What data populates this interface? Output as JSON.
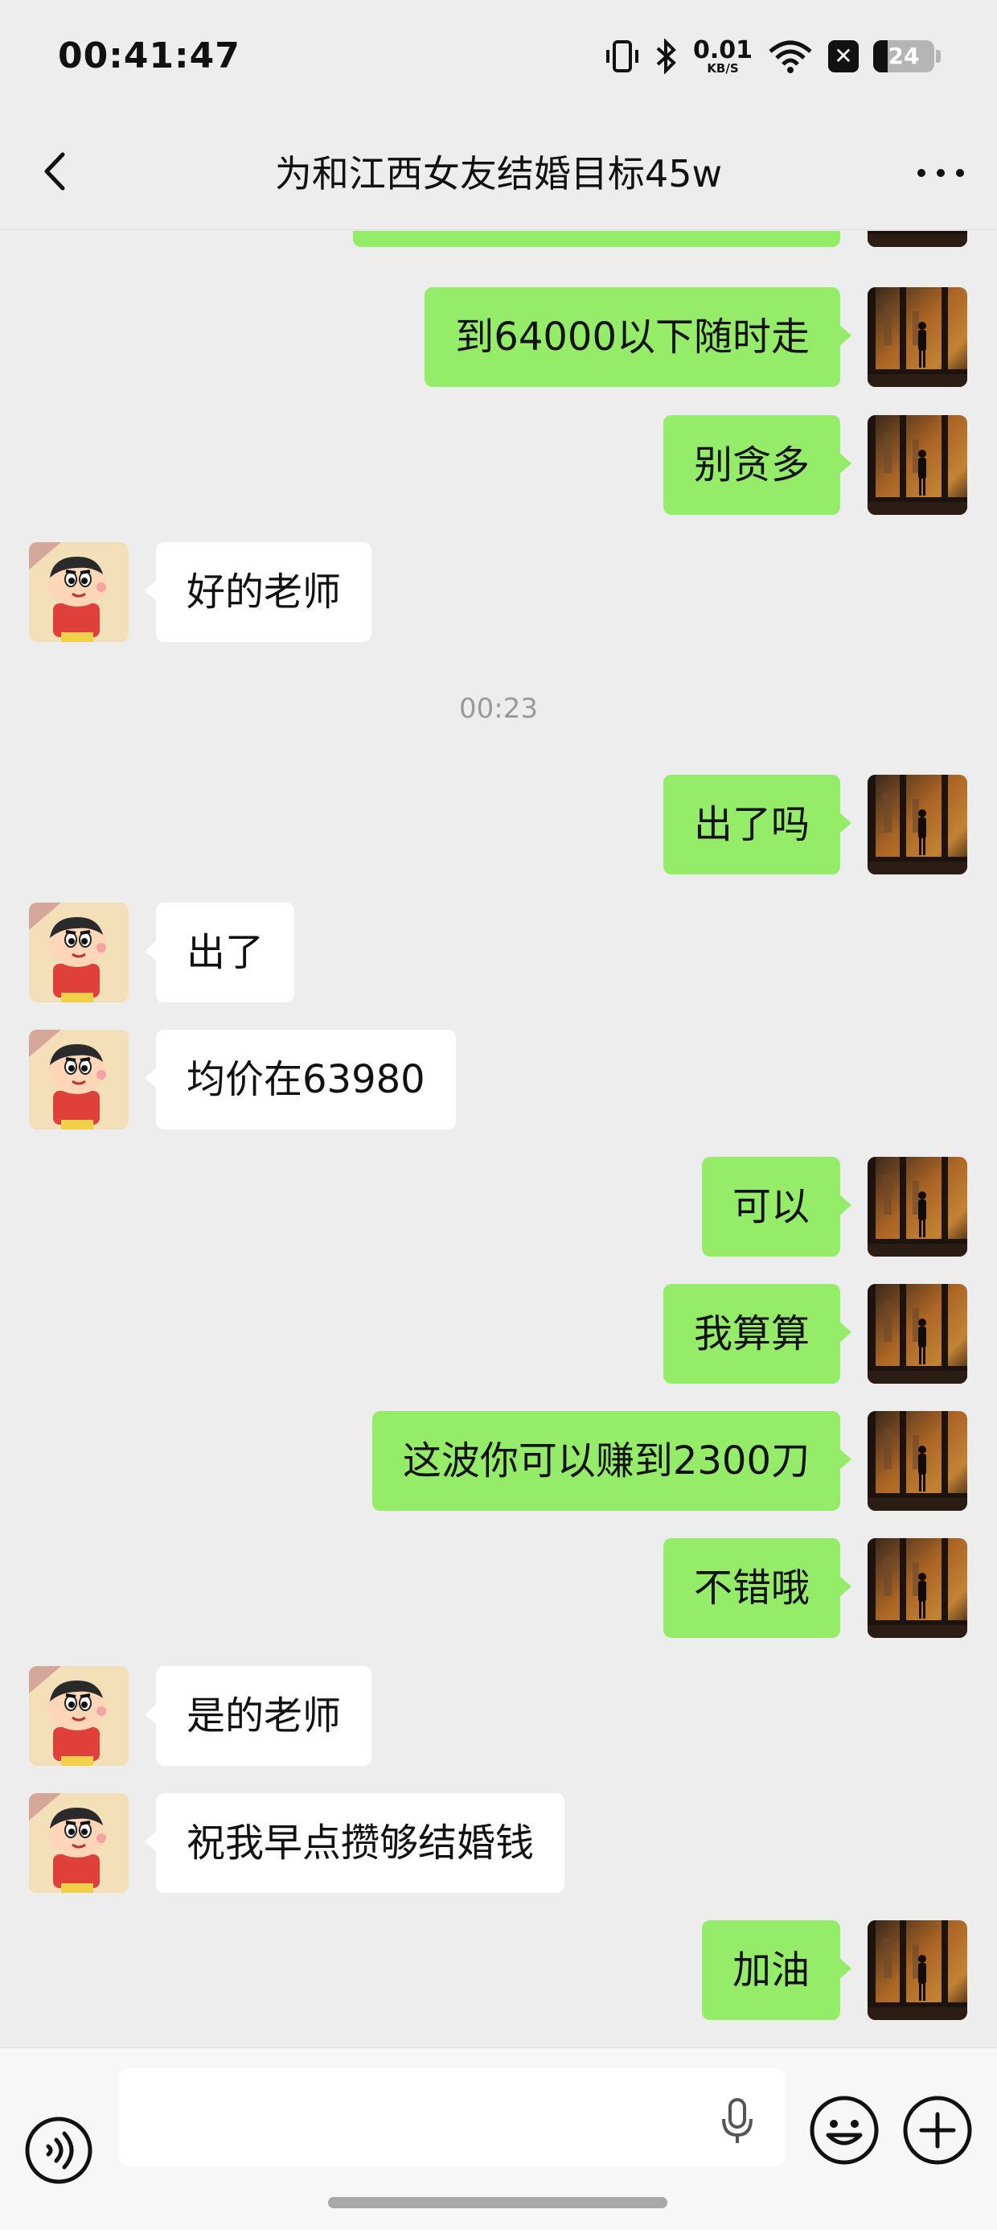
{
  "status_bar": {
    "time": "00:41:47",
    "net_speed_value": "0.01",
    "net_speed_unit": "KB/S",
    "battery": "24",
    "battery_level": 0.24,
    "icons": [
      "vibrate-icon",
      "bluetooth-icon",
      "wifi-icon",
      "x-badge-icon",
      "battery-icon"
    ]
  },
  "header": {
    "title": "为和江西女友结婚目标45w",
    "back_icon": "chevron-left-icon",
    "more_icon": "more-dots-icon"
  },
  "messages": [
    {
      "side": "right",
      "text": "到64000以下随时走"
    },
    {
      "side": "right",
      "text": "别贪多"
    },
    {
      "side": "left",
      "text": "好的老师"
    },
    {
      "type": "time",
      "text": "00:23"
    },
    {
      "side": "right",
      "text": "出了吗"
    },
    {
      "side": "left",
      "text": "出了"
    },
    {
      "side": "left",
      "text": "均价在63980"
    },
    {
      "side": "right",
      "text": "可以"
    },
    {
      "side": "right",
      "text": "我算算"
    },
    {
      "side": "right",
      "text": "这波你可以赚到2300刀"
    },
    {
      "side": "right",
      "text": "不错哦"
    },
    {
      "side": "left",
      "text": "是的老师"
    },
    {
      "side": "left",
      "text": "祝我早点攒够结婚钱"
    },
    {
      "side": "right",
      "text": "加油"
    }
  ],
  "input_bar": {
    "value": "",
    "voice_icon": "voice-mode-icon",
    "mic_icon": "microphone-icon",
    "emoji_icon": "emoji-icon",
    "add_icon": "plus-circle-icon"
  },
  "colors": {
    "background": "#ededed",
    "outgoing_bubble": "#95ec69",
    "incoming_bubble": "#ffffff"
  }
}
